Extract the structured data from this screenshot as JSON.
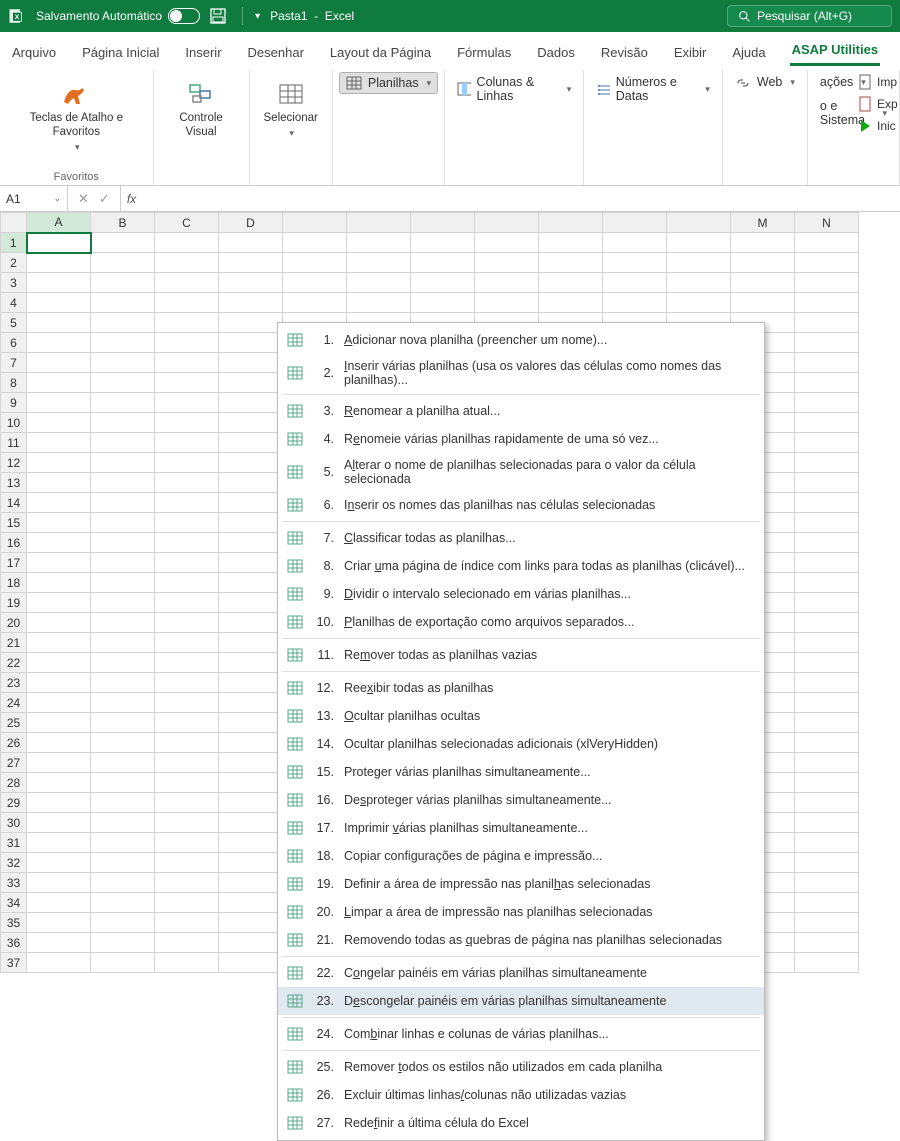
{
  "titlebar": {
    "autosave": "Salvamento Automático",
    "doc": "Pasta1",
    "app": "Excel",
    "search_placeholder": "Pesquisar (Alt+G)"
  },
  "tabs": [
    "Arquivo",
    "Página Inicial",
    "Inserir",
    "Desenhar",
    "Layout da Página",
    "Fórmulas",
    "Dados",
    "Revisão",
    "Exibir",
    "Ajuda",
    "ASAP Utilities"
  ],
  "active_tab": 10,
  "ribbon": {
    "favorites_group": "Favoritos",
    "big1": "Teclas de Atalho e Favoritos",
    "big2": "Controle Visual",
    "big3": "Selecionar",
    "row_btns": {
      "planilhas": "Planilhas",
      "colunas": "Colunas & Linhas",
      "numeros": "Números e Datas",
      "web": "Web"
    },
    "partial": {
      "acoes": "ações",
      "sistema": "o e Sistema",
      "imp": "Imp",
      "exp": "Exp",
      "inic": "Inic"
    }
  },
  "namebox": "A1",
  "columns": [
    "A",
    "B",
    "C",
    "D",
    "",
    "",
    "",
    "",
    "",
    "",
    "",
    "M",
    "N"
  ],
  "sel_col": 0,
  "rows": 37,
  "sel_row": 1,
  "menu": [
    {
      "n": "1.",
      "t": "Adicionar nova planilha (preencher um nome)...",
      "u": "A"
    },
    {
      "n": "2.",
      "t": "Inserir várias planilhas (usa os valores das células como nomes das planilhas)...",
      "u": "I"
    },
    {
      "sep": true
    },
    {
      "n": "3.",
      "t": "Renomear a planilha atual...",
      "u": "R"
    },
    {
      "n": "4.",
      "t": "Renomeie várias planilhas rapidamente de uma só vez...",
      "u": "e"
    },
    {
      "n": "5.",
      "t": "Alterar o nome de planilhas selecionadas para o valor da célula selecionada",
      "u": "l"
    },
    {
      "n": "6.",
      "t": "Inserir os nomes das planilhas nas células selecionadas",
      "u": "n"
    },
    {
      "sep": true
    },
    {
      "n": "7.",
      "t": "Classificar todas as planilhas...",
      "u": "C"
    },
    {
      "n": "8.",
      "t": "Criar uma página de índice com links para todas as planilhas (clicável)...",
      "u": "u"
    },
    {
      "n": "9.",
      "t": "Dividir o intervalo selecionado em várias planilhas...",
      "u": "D"
    },
    {
      "n": "10.",
      "t": "Planilhas de exportação como arquivos separados...",
      "u": "P"
    },
    {
      "sep": true
    },
    {
      "n": "11.",
      "t": "Remover todas as planilhas vazias",
      "u": "m"
    },
    {
      "sep": true
    },
    {
      "n": "12.",
      "t": "Reexibir todas as planilhas",
      "u": "x"
    },
    {
      "n": "13.",
      "t": "Ocultar planilhas ocultas",
      "u": "O"
    },
    {
      "n": "14.",
      "t": "Ocultar planilhas selecionadas adicionais (xlVeryHidden)"
    },
    {
      "n": "15.",
      "t": "Proteger várias planilhas simultaneamente..."
    },
    {
      "n": "16.",
      "t": "Desproteger várias planilhas simultaneamente...",
      "u": "s"
    },
    {
      "n": "17.",
      "t": "Imprimir várias planilhas simultaneamente...",
      "u": "v"
    },
    {
      "n": "18.",
      "t": "Copiar configurações de página e impressão..."
    },
    {
      "n": "19.",
      "t": "Definir a área de impressão nas planilhas selecionadas",
      "u": "h"
    },
    {
      "n": "20.",
      "t": "Limpar a área de impressão nas planilhas selecionadas",
      "u": "L"
    },
    {
      "n": "21.",
      "t": "Removendo todas as quebras de página nas planilhas selecionadas",
      "u": "q"
    },
    {
      "sep": true
    },
    {
      "n": "22.",
      "t": "Congelar painéis em várias planilhas simultaneamente",
      "u": "o"
    },
    {
      "n": "23.",
      "t": "Descongelar painéis em várias planilhas simultaneamente",
      "u": "e",
      "hover": true
    },
    {
      "sep": true
    },
    {
      "n": "24.",
      "t": "Combinar linhas e colunas de várias planilhas...",
      "u": "b"
    },
    {
      "sep": true
    },
    {
      "n": "25.",
      "t": "Remover todos os estilos não utilizados em cada planilha",
      "u": "t"
    },
    {
      "n": "26.",
      "t": "Excluir últimas linhas/colunas não utilizadas vazias",
      "u": "/"
    },
    {
      "n": "27.",
      "t": "Redefinir a última célula do Excel",
      "u": "f"
    }
  ]
}
